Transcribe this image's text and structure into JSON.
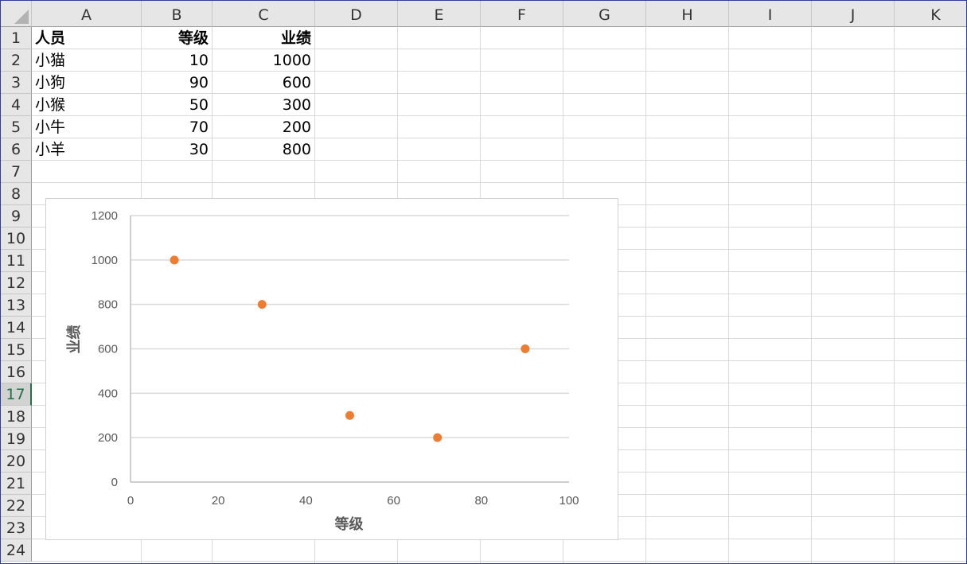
{
  "sheet": {
    "columns": [
      "A",
      "B",
      "C",
      "D",
      "E",
      "F",
      "G",
      "H",
      "I",
      "J",
      "K"
    ],
    "rows": [
      "1",
      "2",
      "3",
      "4",
      "5",
      "6",
      "7",
      "8",
      "9",
      "10",
      "11",
      "12",
      "13",
      "14",
      "15",
      "16",
      "17",
      "18",
      "19",
      "20",
      "21",
      "22",
      "23",
      "24"
    ],
    "active_row": "17"
  },
  "table": {
    "headers": [
      "人员",
      "等级",
      "业绩"
    ],
    "rows": [
      [
        "小猫",
        "10",
        "1000"
      ],
      [
        "小狗",
        "90",
        "600"
      ],
      [
        "小猴",
        "50",
        "300"
      ],
      [
        "小牛",
        "70",
        "200"
      ],
      [
        "小羊",
        "30",
        "800"
      ]
    ]
  },
  "chart_data": {
    "type": "scatter",
    "title": "",
    "xlabel": "等级",
    "ylabel": "业绩",
    "xlim": [
      0,
      100
    ],
    "ylim": [
      0,
      1200
    ],
    "xticks": [
      "0",
      "20",
      "40",
      "60",
      "80",
      "100"
    ],
    "yticks": [
      "0",
      "200",
      "400",
      "600",
      "800",
      "1000",
      "1200"
    ],
    "grid": "horizontal",
    "series": [
      {
        "points": [
          {
            "x": 10,
            "y": 1000
          },
          {
            "x": 90,
            "y": 600
          },
          {
            "x": 50,
            "y": 300
          },
          {
            "x": 70,
            "y": 200
          },
          {
            "x": 30,
            "y": 800
          }
        ]
      }
    ],
    "marker_color": "#ed7d31"
  }
}
